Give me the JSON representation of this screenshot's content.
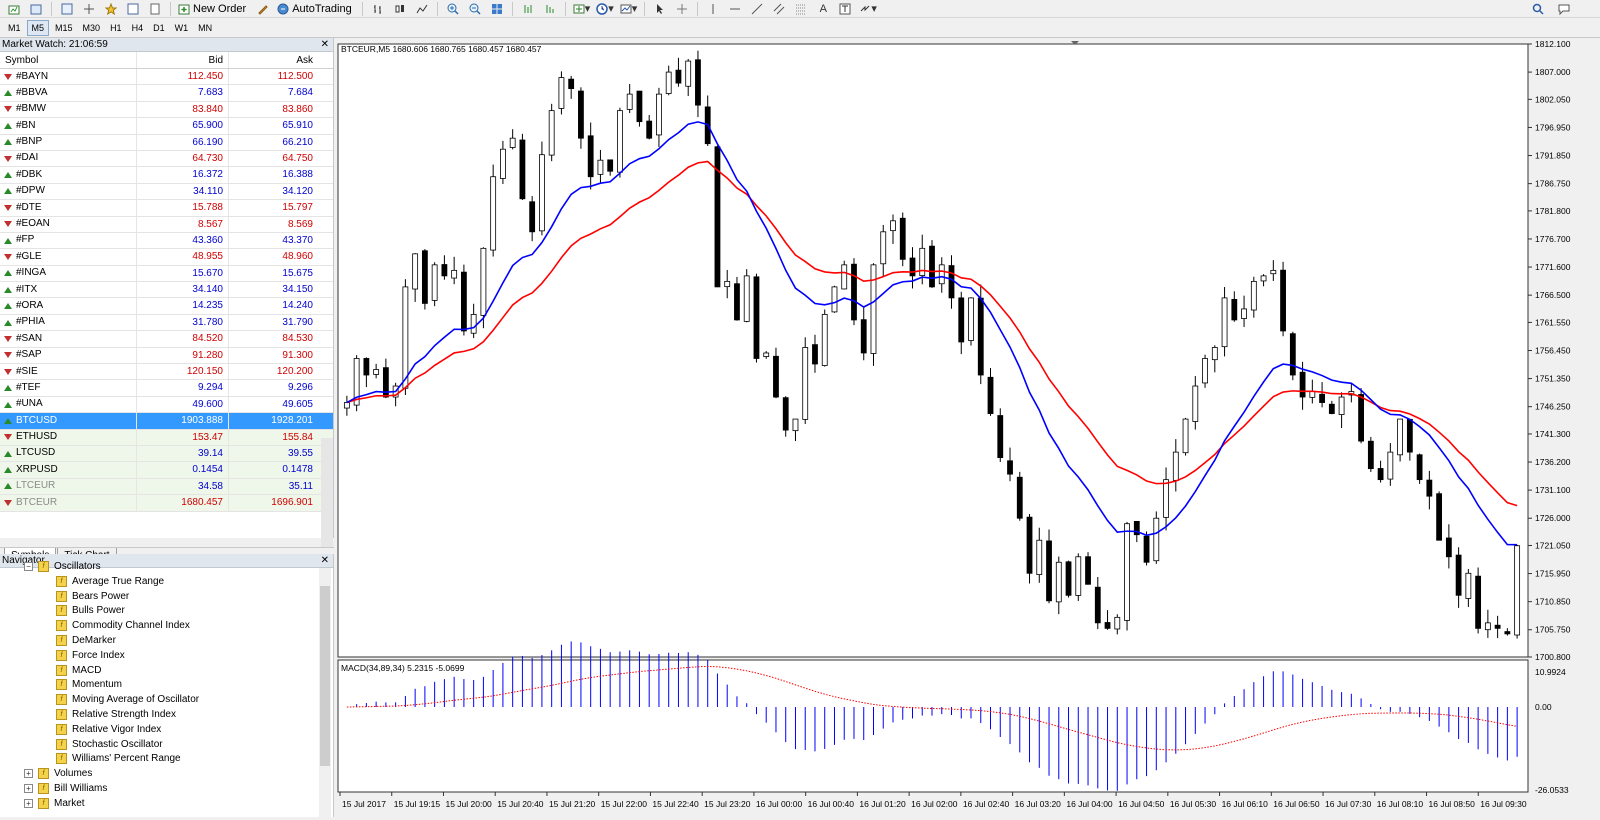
{
  "toolbar": {
    "new_order": "New Order",
    "autotrading": "AutoTrading"
  },
  "timeframes": [
    "M1",
    "M5",
    "M15",
    "M30",
    "H1",
    "H4",
    "D1",
    "W1",
    "MN"
  ],
  "active_timeframe": "M5",
  "market_watch": {
    "title": "Market Watch: 21:06:59",
    "col_symbol": "Symbol",
    "col_bid": "Bid",
    "col_ask": "Ask",
    "rows": [
      {
        "symbol": "#BAYN",
        "bid": "112.450",
        "ask": "112.500",
        "dir": "down",
        "color": "red"
      },
      {
        "symbol": "#BBVA",
        "bid": "7.683",
        "ask": "7.684",
        "dir": "up",
        "color": "blue"
      },
      {
        "symbol": "#BMW",
        "bid": "83.840",
        "ask": "83.860",
        "dir": "down",
        "color": "red"
      },
      {
        "symbol": "#BN",
        "bid": "65.900",
        "ask": "65.910",
        "dir": "up",
        "color": "blue"
      },
      {
        "symbol": "#BNP",
        "bid": "66.190",
        "ask": "66.210",
        "dir": "up",
        "color": "blue"
      },
      {
        "symbol": "#DAI",
        "bid": "64.730",
        "ask": "64.750",
        "dir": "down",
        "color": "red"
      },
      {
        "symbol": "#DBK",
        "bid": "16.372",
        "ask": "16.388",
        "dir": "up",
        "color": "blue"
      },
      {
        "symbol": "#DPW",
        "bid": "34.110",
        "ask": "34.120",
        "dir": "up",
        "color": "blue"
      },
      {
        "symbol": "#DTE",
        "bid": "15.788",
        "ask": "15.797",
        "dir": "down",
        "color": "red"
      },
      {
        "symbol": "#EOAN",
        "bid": "8.567",
        "ask": "8.569",
        "dir": "down",
        "color": "red"
      },
      {
        "symbol": "#FP",
        "bid": "43.360",
        "ask": "43.370",
        "dir": "up",
        "color": "blue"
      },
      {
        "symbol": "#GLE",
        "bid": "48.955",
        "ask": "48.960",
        "dir": "down",
        "color": "red"
      },
      {
        "symbol": "#INGA",
        "bid": "15.670",
        "ask": "15.675",
        "dir": "up",
        "color": "blue"
      },
      {
        "symbol": "#ITX",
        "bid": "34.140",
        "ask": "34.150",
        "dir": "up",
        "color": "blue"
      },
      {
        "symbol": "#ORA",
        "bid": "14.235",
        "ask": "14.240",
        "dir": "up",
        "color": "blue"
      },
      {
        "symbol": "#PHIA",
        "bid": "31.780",
        "ask": "31.790",
        "dir": "up",
        "color": "blue"
      },
      {
        "symbol": "#SAN",
        "bid": "84.520",
        "ask": "84.530",
        "dir": "down",
        "color": "red"
      },
      {
        "symbol": "#SAP",
        "bid": "91.280",
        "ask": "91.300",
        "dir": "down",
        "color": "red"
      },
      {
        "symbol": "#SIE",
        "bid": "120.150",
        "ask": "120.200",
        "dir": "down",
        "color": "red"
      },
      {
        "symbol": "#TEF",
        "bid": "9.294",
        "ask": "9.296",
        "dir": "up",
        "color": "blue"
      },
      {
        "symbol": "#UNA",
        "bid": "49.600",
        "ask": "49.605",
        "dir": "up",
        "color": "blue"
      },
      {
        "symbol": "BTCUSD",
        "bid": "1903.888",
        "ask": "1928.201",
        "dir": "up",
        "color": "blue",
        "selected": true
      },
      {
        "symbol": "ETHUSD",
        "bid": "153.47",
        "ask": "155.84",
        "dir": "down",
        "color": "red",
        "crypto": true
      },
      {
        "symbol": "LTCUSD",
        "bid": "39.14",
        "ask": "39.55",
        "dir": "up",
        "color": "blue",
        "crypto": true
      },
      {
        "symbol": "XRPUSD",
        "bid": "0.1454",
        "ask": "0.1478",
        "dir": "up",
        "color": "blue",
        "crypto": true
      },
      {
        "symbol": "LTCEUR",
        "bid": "34.58",
        "ask": "35.11",
        "dir": "up",
        "color": "blue",
        "crypto": true,
        "dim": true
      },
      {
        "symbol": "BTCEUR",
        "bid": "1680.457",
        "ask": "1696.901",
        "dir": "down",
        "color": "red",
        "crypto": true,
        "dim": true
      }
    ],
    "tabs": [
      "Symbols",
      "Tick Chart"
    ]
  },
  "navigator": {
    "title": "Navigator",
    "group": "Oscillators",
    "items": [
      "Average True Range",
      "Bears Power",
      "Bulls Power",
      "Commodity Channel Index",
      "DeMarker",
      "Force Index",
      "MACD",
      "Momentum",
      "Moving Average of Oscillator",
      "Relative Strength Index",
      "Relative Vigor Index",
      "Stochastic Oscillator",
      "Williams' Percent Range"
    ],
    "other_groups": [
      "Volumes",
      "Bill Williams",
      "Market"
    ]
  },
  "chart": {
    "header": "BTCEUR,M5  1680.606 1680.765 1680.457 1680.457",
    "macd_header": "MACD(34,89,34) 5.2315 -5.0699",
    "price_ticks": [
      "1812.100",
      "1807.000",
      "1802.050",
      "1796.950",
      "1791.850",
      "1786.750",
      "1781.800",
      "1776.700",
      "1771.600",
      "1766.500",
      "1761.550",
      "1756.450",
      "1751.350",
      "1746.250",
      "1741.300",
      "1736.200",
      "1731.100",
      "1726.000",
      "1721.050",
      "1715.950",
      "1710.850",
      "1705.750",
      "1700.800"
    ],
    "macd_ticks": [
      "10.9924",
      "0.00",
      "-26.0533"
    ],
    "time_ticks": [
      "15 Jul 2017",
      "15 Jul 19:15",
      "15 Jul 20:00",
      "15 Jul 20:40",
      "15 Jul 21:20",
      "15 Jul 22:00",
      "15 Jul 22:40",
      "15 Jul 23:20",
      "16 Jul 00:00",
      "16 Jul 00:40",
      "16 Jul 01:20",
      "16 Jul 02:00",
      "16 Jul 02:40",
      "16 Jul 03:20",
      "16 Jul 04:00",
      "16 Jul 04:50",
      "16 Jul 05:30",
      "16 Jul 06:10",
      "16 Jul 06:50",
      "16 Jul 07:30",
      "16 Jul 08:10",
      "16 Jul 08:50",
      "16 Jul 09:30"
    ],
    "colors": {
      "ma_fast": "#0000ff",
      "ma_slow": "#ff0000",
      "macd_hist": "#0000ff",
      "macd_signal": "#ff0000",
      "bg": "#ffffff"
    }
  },
  "chart_data": {
    "type": "candlestick",
    "ylim": [
      1700.8,
      1812.1
    ],
    "closes": [
      1747,
      1755,
      1752,
      1753,
      1748,
      1750,
      1768,
      1774,
      1765,
      1772,
      1770,
      1771,
      1760,
      1763,
      1775,
      1788,
      1793,
      1795,
      1784,
      1778,
      1792,
      1800,
      1806,
      1804,
      1795,
      1788,
      1791,
      1789,
      1800,
      1803,
      1798,
      1795,
      1803,
      1807,
      1805,
      1809,
      1801,
      1794,
      1768,
      1769,
      1762,
      1770,
      1755,
      1756,
      1748,
      1742,
      1744,
      1757,
      1754,
      1763,
      1768,
      1772,
      1762,
      1756,
      1772,
      1778,
      1780,
      1773,
      1770,
      1775,
      1768,
      1772,
      1766,
      1758,
      1766,
      1752,
      1745,
      1737,
      1734,
      1726,
      1716,
      1722,
      1711,
      1718,
      1712,
      1719,
      1714,
      1707,
      1706,
      1708,
      1725,
      1723,
      1718,
      1726,
      1733,
      1738,
      1744,
      1750,
      1755,
      1757,
      1766,
      1762,
      1764,
      1769,
      1770,
      1771,
      1760,
      1752,
      1748,
      1749,
      1747,
      1745,
      1748,
      1749,
      1740,
      1735,
      1733,
      1738,
      1744,
      1738,
      1733,
      1730,
      1722,
      1719,
      1712,
      1716,
      1706,
      1707,
      1706,
      1705,
      1721
    ]
  }
}
